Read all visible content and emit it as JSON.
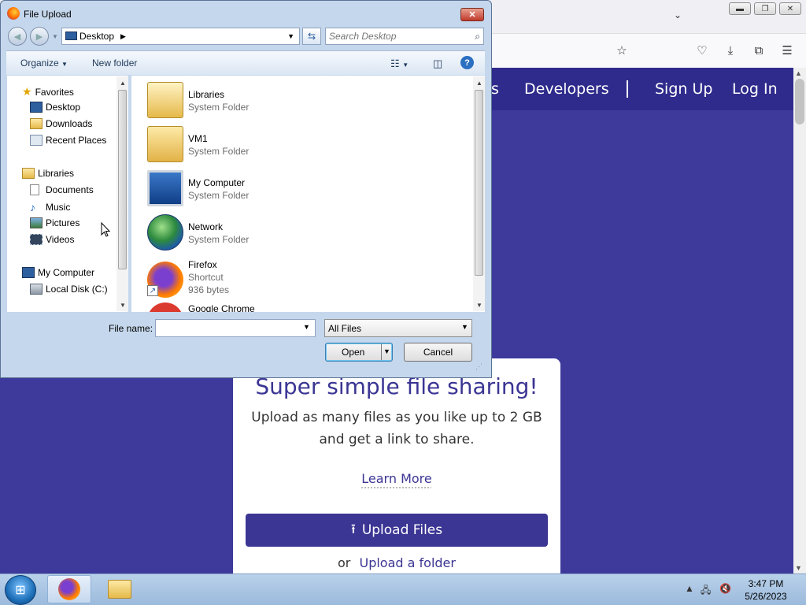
{
  "browser": {
    "toolbar_icons": [
      "bookmark-star-icon",
      "pocket-icon",
      "download-icon",
      "extensions-icon",
      "menu-icon"
    ]
  },
  "site": {
    "nav_partial": "s",
    "nav_developers": "Developers",
    "nav_signup": "Sign Up",
    "nav_login": "Log In",
    "headline": "Super simple file sharing!",
    "subtext_line1": "Upload as many files as you like up to 2 GB",
    "subtext_line2": "and get a link to share.",
    "learn_more": "Learn More",
    "upload_button": "Upload Files",
    "or_text": "or",
    "upload_folder": "Upload a folder",
    "accent_color": "#3b3594"
  },
  "dialog": {
    "title": "File Upload",
    "address": "Desktop",
    "search_placeholder": "Search Desktop",
    "organize": "Organize",
    "new_folder": "New folder",
    "nav_tree": [
      {
        "label": "Favorites",
        "icon": "star-icon"
      },
      {
        "label": "Desktop",
        "icon": "desktop-icon"
      },
      {
        "label": "Downloads",
        "icon": "downloads-folder-icon"
      },
      {
        "label": "Recent Places",
        "icon": "recent-places-icon"
      },
      {
        "label": "Libraries",
        "icon": "libraries-icon"
      },
      {
        "label": "Documents",
        "icon": "documents-icon"
      },
      {
        "label": "Music",
        "icon": "music-icon"
      },
      {
        "label": "Pictures",
        "icon": "pictures-icon"
      },
      {
        "label": "Videos",
        "icon": "videos-icon"
      },
      {
        "label": "My Computer",
        "icon": "computer-icon"
      },
      {
        "label": "Local Disk (C:)",
        "icon": "disk-icon"
      }
    ],
    "files": [
      {
        "name": "Libraries",
        "type": "System Folder",
        "size": "",
        "icon": "libraries-folder-icon"
      },
      {
        "name": "VM1",
        "type": "System Folder",
        "size": "",
        "icon": "user-folder-icon"
      },
      {
        "name": "My Computer",
        "type": "System Folder",
        "size": "",
        "icon": "computer-icon"
      },
      {
        "name": "Network",
        "type": "System Folder",
        "size": "",
        "icon": "network-icon"
      },
      {
        "name": "Firefox",
        "type": "Shortcut",
        "size": "936 bytes",
        "icon": "firefox-icon"
      },
      {
        "name": "Google Chrome",
        "type": "",
        "size": "",
        "icon": "chrome-icon"
      }
    ],
    "filename_label": "File name:",
    "filename_value": "",
    "filetype_value": "All Files",
    "open_label": "Open",
    "cancel_label": "Cancel"
  },
  "taskbar": {
    "time": "3:47 PM",
    "date": "5/26/2023"
  }
}
